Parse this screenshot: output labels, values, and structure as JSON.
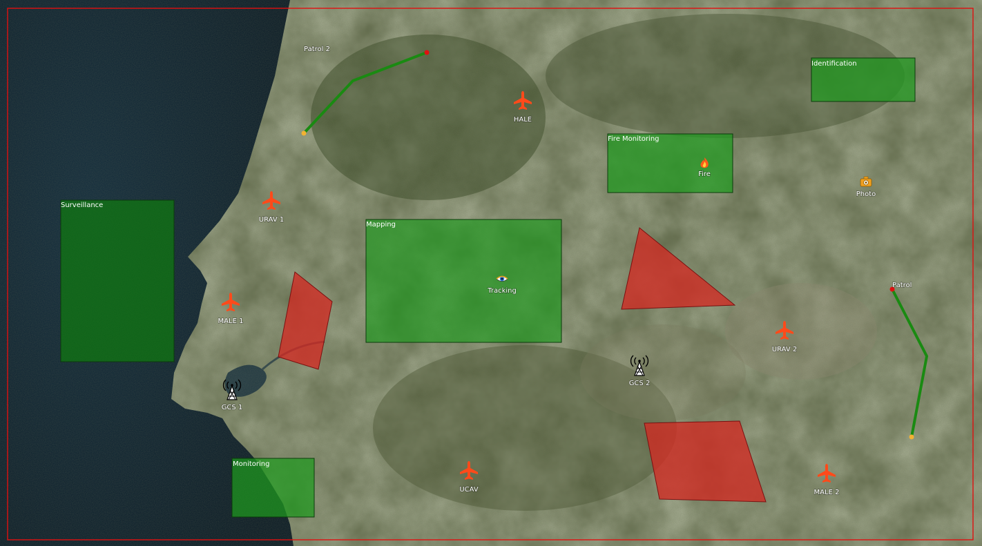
{
  "colors": {
    "sea": "#0d2334",
    "land": "#4f5a3c",
    "zone_green": "#1f9a1f",
    "zone_red": "#d22a22",
    "route": "#1a8a12",
    "aircraft": "#ff4a1a",
    "frame": "#e01010",
    "route_start": "#f2b233",
    "route_end": "#e01010"
  },
  "zones": {
    "surveillance": "Surveillance",
    "mapping": "Mapping",
    "monitoring": "Monitoring",
    "fire_monitoring": "Fire Monitoring",
    "identification": "Identification"
  },
  "routes": {
    "patrol_2": "Patrol 2",
    "patrol": "Patrol"
  },
  "aircraft": [
    {
      "label": "HALE",
      "icon": "airplane-icon"
    },
    {
      "label": "URAV 1",
      "icon": "airplane-icon"
    },
    {
      "label": "MALE 1",
      "icon": "airplane-icon"
    },
    {
      "label": "URAV 2",
      "icon": "airplane-icon"
    },
    {
      "label": "UCAV",
      "icon": "airplane-icon"
    },
    {
      "label": "MALE 2",
      "icon": "airplane-icon"
    }
  ],
  "ground_stations": [
    {
      "label": "GCS 1",
      "icon": "antenna-tower-icon"
    },
    {
      "label": "GCS 2",
      "icon": "antenna-tower-icon"
    }
  ],
  "targets": {
    "tracking": {
      "label": "Tracking",
      "icon": "eye-icon"
    },
    "fire": {
      "label": "Fire",
      "icon": "flame-icon"
    },
    "photo": {
      "label": "Photo",
      "icon": "camera-icon"
    }
  }
}
